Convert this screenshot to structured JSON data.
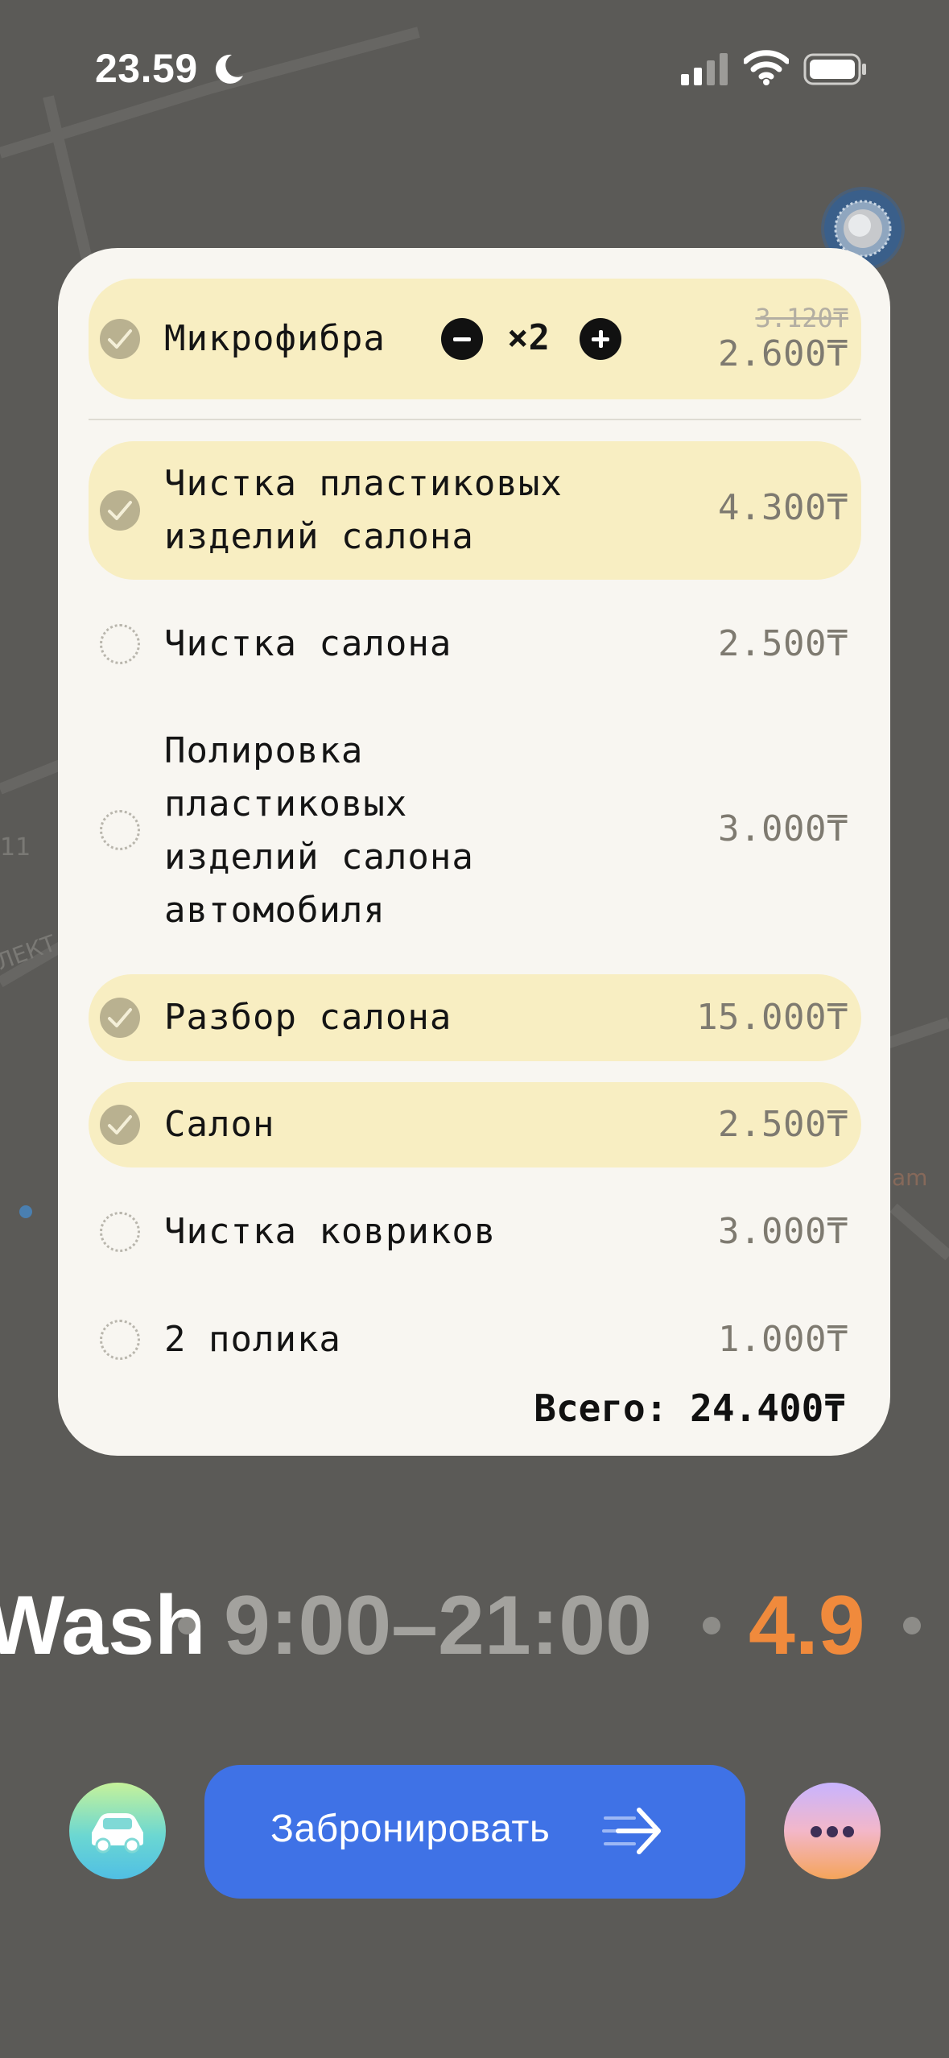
{
  "status_bar": {
    "time": "23.59"
  },
  "items": [
    {
      "label": "Микрофибра",
      "old_price": "3.120₸",
      "price": "2.600₸",
      "selected": true,
      "quantity": "×2"
    },
    {
      "label": "Чистка пластиковых\nизделий салона",
      "price": "4.300₸",
      "selected": true
    },
    {
      "label": "Чистка салона",
      "price": "2.500₸",
      "selected": false
    },
    {
      "label": "Полировка\nпластиковых\nизделий салона\nавтомобиля",
      "price": "3.000₸",
      "selected": false
    },
    {
      "label": "Разбор салона",
      "price": "15.000₸",
      "selected": true
    },
    {
      "label": "Салон",
      "price": "2.500₸",
      "selected": true
    },
    {
      "label": "Чистка ковриков",
      "price": "3.000₸",
      "selected": false
    },
    {
      "label": "2 полика",
      "price": "1.000₸",
      "selected": false
    }
  ],
  "total": "Всего: 24.400₸",
  "info": {
    "name": "Wash",
    "hours": "9:00–21:00",
    "rating": "4.9"
  },
  "bottom": {
    "book_label": "Забронировать"
  },
  "colors": {
    "accent": "#3f72e6",
    "rating": "#f08a3c",
    "selected_row": "#f8eec2"
  }
}
